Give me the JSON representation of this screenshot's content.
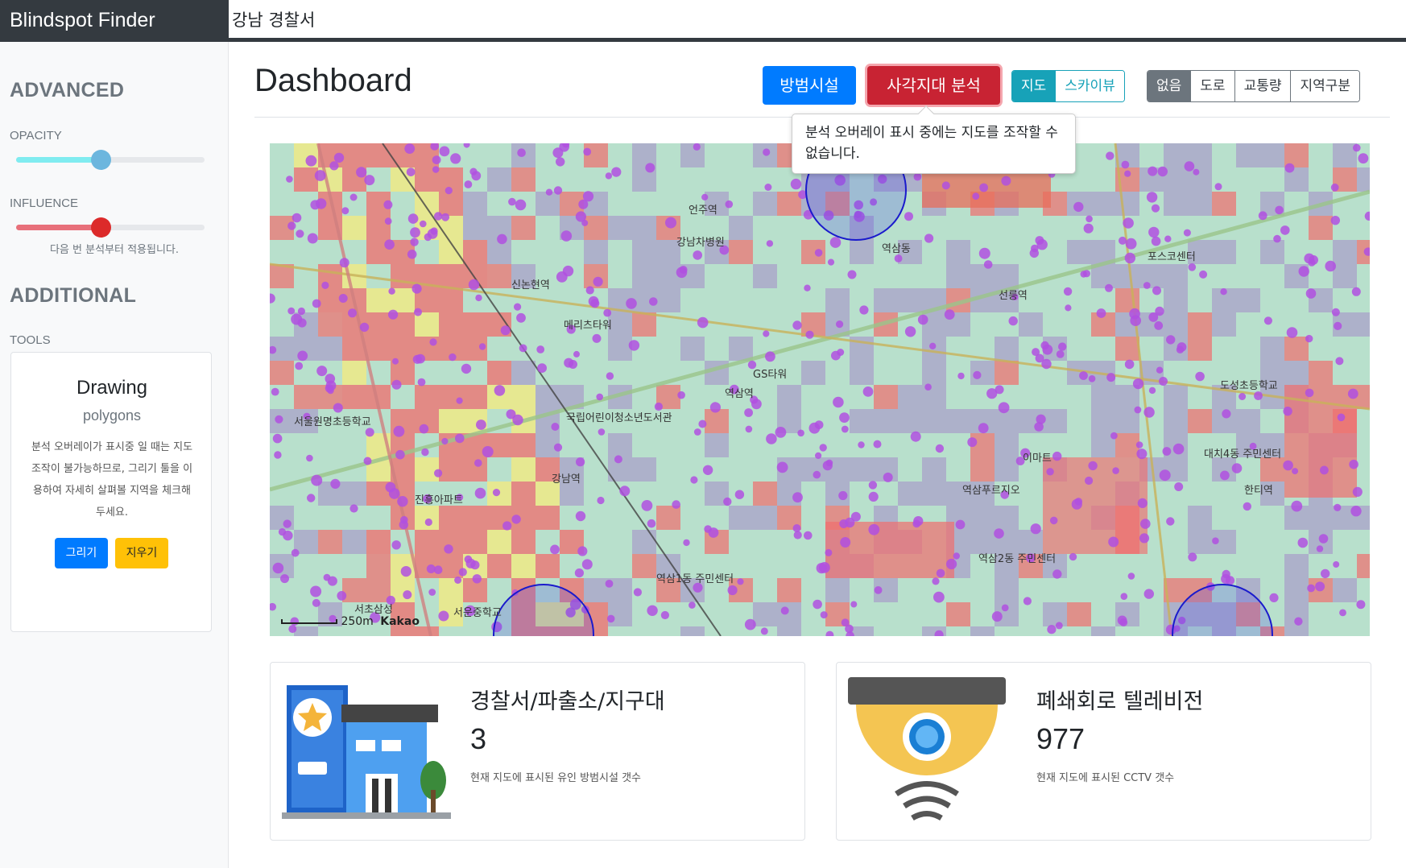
{
  "brand": "Blindspot Finder",
  "search": {
    "value": "강남 경찰서"
  },
  "sidebar": {
    "advanced_heading": "ADVANCED",
    "opacity_label": "OPACITY",
    "opacity_value": 0.45,
    "influence_label": "INFLUENCE",
    "influence_value": 0.45,
    "influence_hint": "다음 번 분석부터 적용됩니다.",
    "additional_heading": "ADDITIONAL",
    "tools_label": "TOOLS",
    "tools_card": {
      "title": "Drawing",
      "subtitle": "polygons",
      "body": "분석 오버레이가 표시중 일 때는 지도 조작이 불가능하므로, 그리기 툴을 이용하여 자세히 살펴볼 지역을 체크해 두세요.",
      "draw_button": "그리기",
      "erase_button": "지우기"
    }
  },
  "header": {
    "title": "Dashboard",
    "facility_button": "방범시설",
    "analysis_button": "사각지대 분석",
    "map_type": {
      "options": [
        "지도",
        "스카이뷰"
      ],
      "active": "지도"
    },
    "overlay": {
      "options": [
        "없음",
        "도로",
        "교통량",
        "지역구분"
      ],
      "active": "없음"
    }
  },
  "tooltip": "분석 오버레이 표시 중에는 지도를 조작할 수 없습니다.",
  "map": {
    "scale_label": "250m",
    "provider": "Kakao",
    "labels": [
      "언주역",
      "신논현역",
      "강남역",
      "역삼역",
      "선릉역",
      "한티역",
      "강남차병원",
      "역삼동",
      "GS타워",
      "이마트",
      "포스코센터",
      "서울원명초등학교",
      "진흥아파트",
      "서초삼성",
      "서운중학교",
      "역삼1동 주민센터",
      "역삼2동 주민센터",
      "대치4동 주민센터",
      "도성초등학교",
      "역삼푸르지오",
      "메리츠타워",
      "국립어린이청소년도서관"
    ]
  },
  "cards": [
    {
      "title": "경찰서/파출소/지구대",
      "value": "3",
      "desc": "현재 지도에 표시된 유인 방범시설 갯수",
      "icon": "police-station-icon"
    },
    {
      "title": "폐쇄회로 텔레비전",
      "value": "977",
      "desc": "현재 지도에 표시된 CCTV 갯수",
      "icon": "cctv-camera-icon"
    }
  ],
  "colors": {
    "primary": "#007bff",
    "danger": "#dc3545",
    "info": "#17a2b8",
    "secondary": "#6c757d",
    "warning": "#ffc107",
    "overlay_red": "#f08080",
    "overlay_purple": "#9b59d0",
    "overlay_green": "#b8e0cc"
  }
}
